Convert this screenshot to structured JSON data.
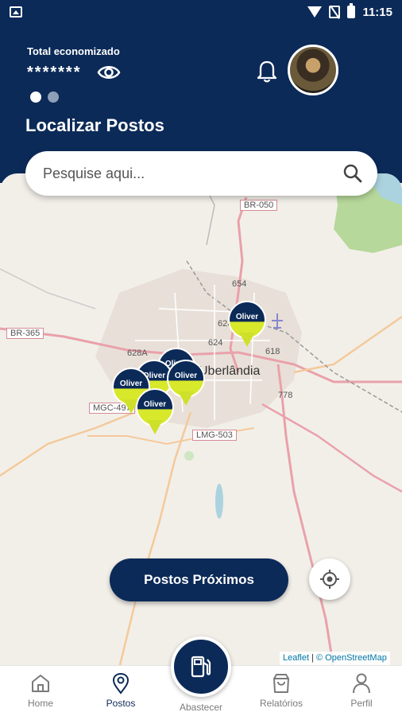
{
  "status_bar": {
    "time": "11:15"
  },
  "header": {
    "total_label": "Total economizado",
    "total_value": "*******",
    "title": "Localizar Postos"
  },
  "search": {
    "placeholder": "Pesquise aqui..."
  },
  "map": {
    "city_label": "Uberlândia",
    "road_labels": [
      "BR-050",
      "BR-365",
      "MGC-497",
      "LMG-503",
      "654",
      "628",
      "624",
      "618",
      "628A",
      "778"
    ],
    "pin_label": "Oliver",
    "attribution_leaflet": "Leaflet",
    "attribution_osm": "© OpenStreetMap"
  },
  "buttons": {
    "near": "Postos Próximos"
  },
  "nav": {
    "home": "Home",
    "postos": "Postos",
    "abastecer": "Abastecer",
    "relatorios": "Relatórios",
    "perfil": "Perfil"
  },
  "colors": {
    "primary": "#0b2a58",
    "accent": "#cfe02a"
  }
}
